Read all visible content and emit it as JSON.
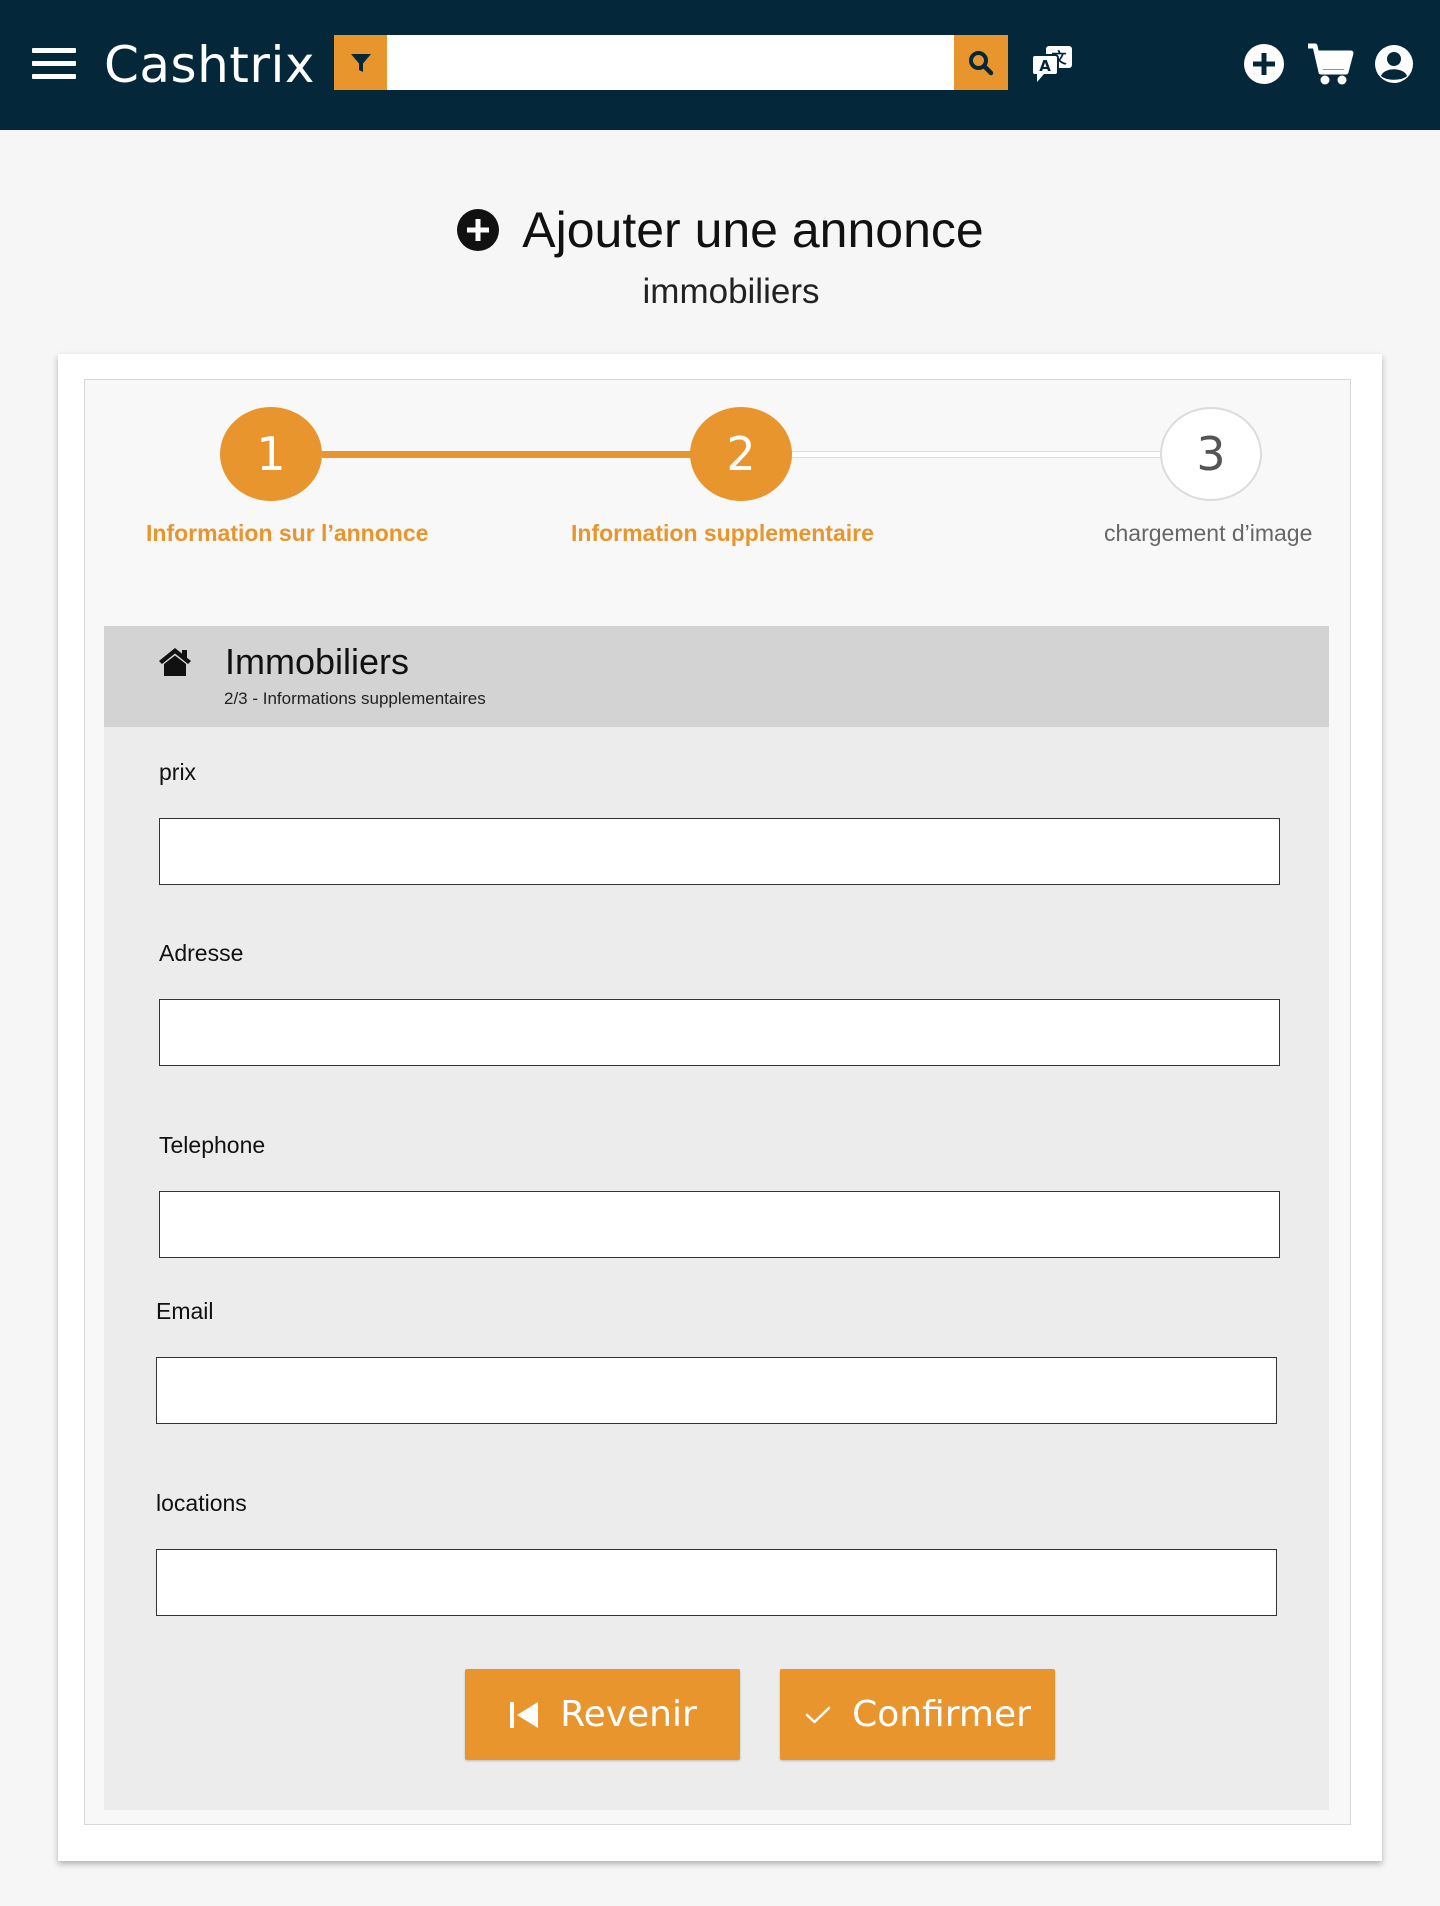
{
  "header": {
    "brand": "Cashtrix",
    "search_placeholder": "",
    "icons": [
      "menu-icon",
      "filter-icon",
      "search-icon",
      "translate-icon",
      "add-circle-icon",
      "cart-icon",
      "account-icon"
    ]
  },
  "page": {
    "title": "Ajouter une annonce",
    "subtitle": "immobiliers"
  },
  "stepper": {
    "current_step": 2,
    "steps": [
      {
        "number": "1",
        "label": "Information sur l’annonce",
        "state": "done"
      },
      {
        "number": "2",
        "label": "Information supplementaire",
        "state": "active"
      },
      {
        "number": "3",
        "label": "chargement d’image",
        "state": "todo"
      }
    ]
  },
  "section": {
    "title": "Immobiliers",
    "subtitle": "2/3 - Informations supplementaires",
    "icon": "house-icon"
  },
  "form": {
    "fields": [
      {
        "label": "prix",
        "value": "",
        "placeholder": ""
      },
      {
        "label": "Adresse",
        "value": "",
        "placeholder": ""
      },
      {
        "label": "Telephone",
        "value": "",
        "placeholder": ""
      },
      {
        "label": "Email",
        "value": "",
        "placeholder": ""
      },
      {
        "label": "locations",
        "value": "",
        "placeholder": ""
      }
    ],
    "back_label": "Revenir",
    "confirm_label": "Confirmer"
  },
  "colors": {
    "topbar": "#04283a",
    "accent": "#e8952d",
    "page_background": "#f6f6f6",
    "section_header": "#d3d3d3",
    "section_body": "#ececec"
  }
}
